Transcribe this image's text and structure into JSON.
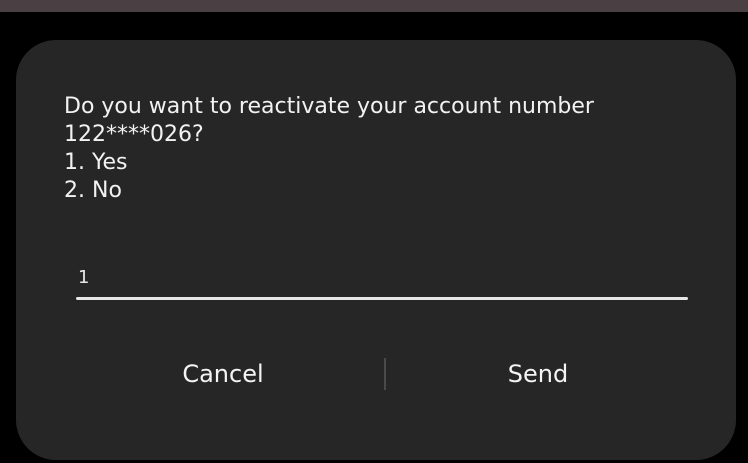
{
  "dialog": {
    "message_lines": [
      "Do you want to reactivate your account number",
      "122****026?",
      "1. Yes",
      "2. No"
    ],
    "input_value": "1",
    "cancel_label": "Cancel",
    "send_label": "Send"
  },
  "colors": {
    "dialog_background": "#262626",
    "text": "#f2f2f2",
    "top_bar": "#4a4044"
  }
}
